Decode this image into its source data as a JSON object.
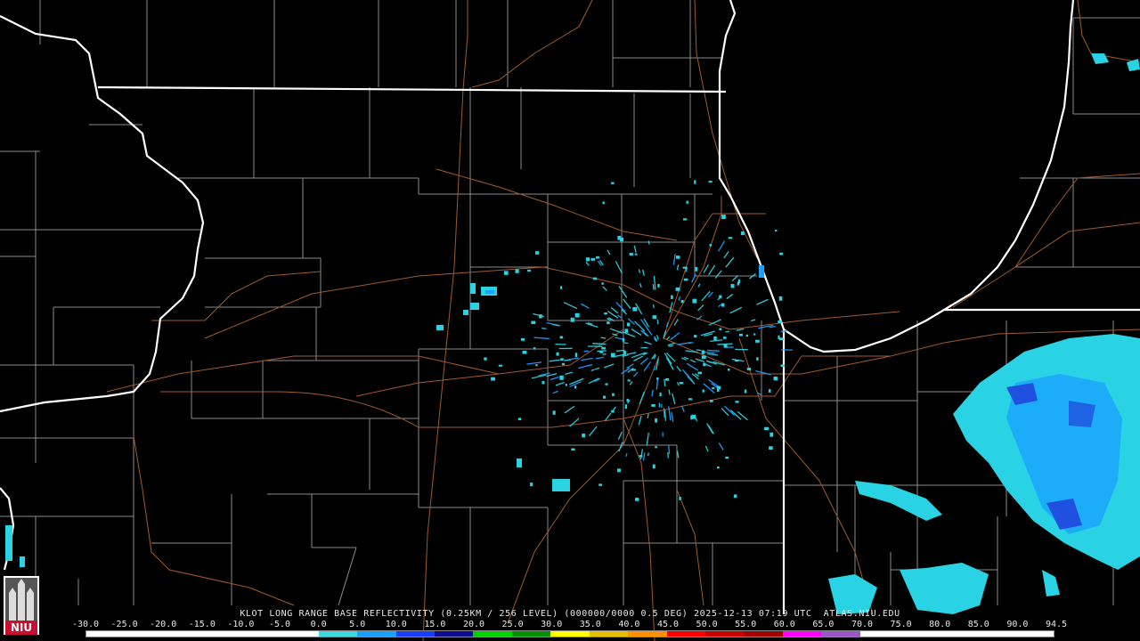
{
  "caption": "KLOT LONG RANGE BASE REFLECTIVITY (0.25KM / 256 LEVEL) (000000/0000 0.5 DEG) 2025-12-13 07:19 UTC  ATLAS.NIU.EDU",
  "scale": {
    "labels": [
      "-30.0",
      "-25.0",
      "-20.0",
      "-15.0",
      "-10.0",
      "-5.0",
      "0.0",
      "5.0",
      "10.0",
      "15.0",
      "20.0",
      "25.0",
      "30.0",
      "35.0",
      "40.0",
      "45.0",
      "50.0",
      "55.0",
      "60.0",
      "65.0",
      "70.0",
      "75.0",
      "80.0",
      "85.0",
      "90.0",
      "94.5"
    ],
    "colors": [
      "#ffffff",
      "#ffffff",
      "#ffffff",
      "#ffffff",
      "#ffffff",
      "#ffffff",
      "#3fd7e0",
      "#1aa0ff",
      "#1c3cff",
      "#0d0d8c",
      "#00d200",
      "#009000",
      "#ffff00",
      "#e6c000",
      "#ff9000",
      "#ff0000",
      "#c80000",
      "#a00000",
      "#ff00ff",
      "#9b55c9",
      "#ffffff",
      "#ffffff",
      "#ffffff",
      "#ffffff",
      "#ffffff"
    ]
  },
  "logo": {
    "text": "NIU",
    "color": "#c8102e"
  },
  "colors": {
    "state_border": "#ffffff",
    "county": "#8a8a8a",
    "highway": "#a05a2c",
    "echo_light": "#29d3e3",
    "echo_mid": "#1aa0ff",
    "echo_heavy": "#2050e0"
  }
}
